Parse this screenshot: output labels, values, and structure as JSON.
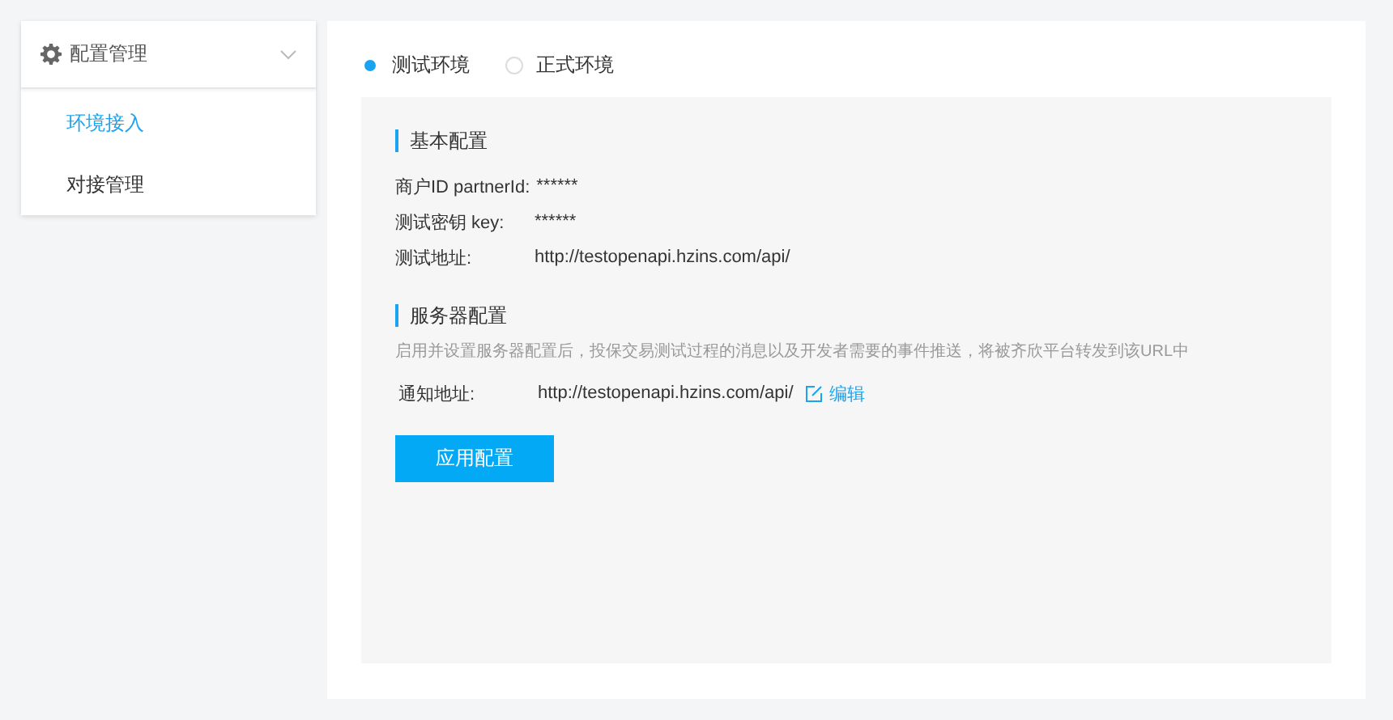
{
  "sidebar": {
    "group": "配置管理",
    "items": [
      {
        "label": "环境接入",
        "selected": true
      },
      {
        "label": "对接管理",
        "selected": false
      }
    ]
  },
  "environments": [
    {
      "label": "测试环境",
      "selected": true
    },
    {
      "label": "正式环境",
      "selected": false
    }
  ],
  "sections": [
    {
      "title": "基本配置",
      "fields": [
        {
          "label": "商户ID partnerId:",
          "value": "******"
        },
        {
          "label": "测试密钥 key:",
          "value": "******"
        },
        {
          "label": "测试地址:",
          "value": "http://testopenapi.hzins.com/api/"
        }
      ]
    },
    {
      "title": "服务器配置",
      "note": "启用并设置服务器配置后，投保交易测试过程的消息以及开发者需要的事件推送，将被齐欣平台转发到该URL中",
      "fields": [
        {
          "label": "通知地址:",
          "value": "http://testopenapi.hzins.com/api/",
          "action": "编辑"
        }
      ]
    }
  ],
  "apply_button": "应用配置"
}
